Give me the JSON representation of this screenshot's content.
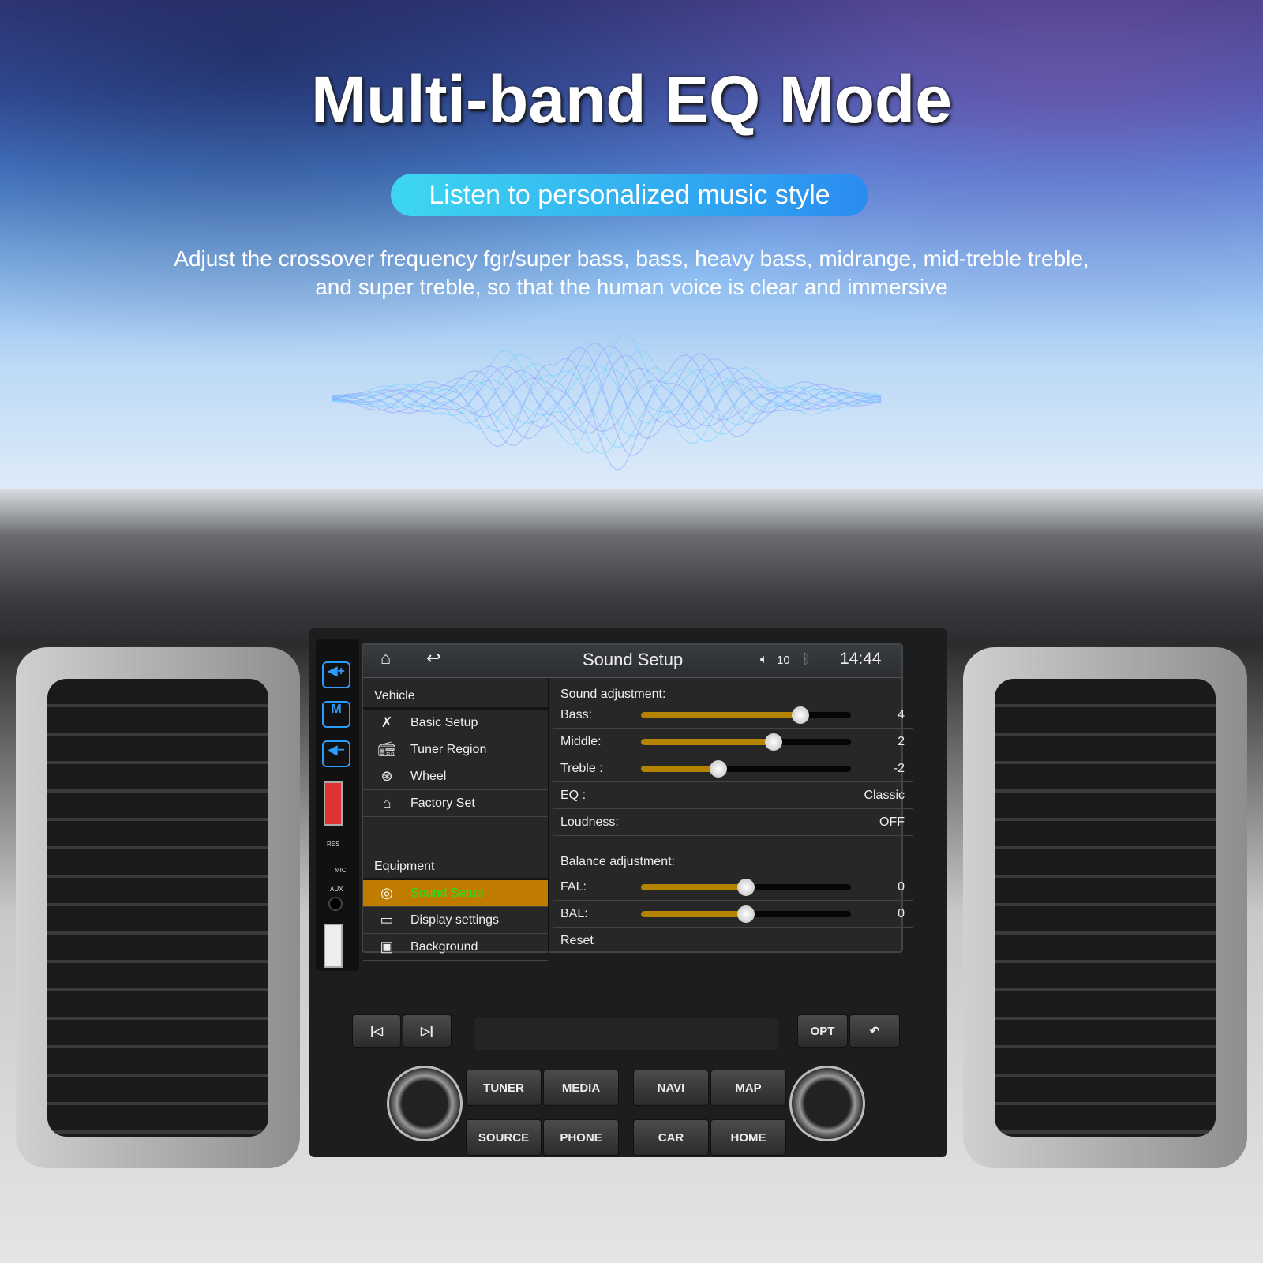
{
  "hero": {
    "title": "Multi-band EQ Mode",
    "subtitle": "Listen to personalized music style",
    "desc_line1": "Adjust the crossover frequency fgr/super bass, bass, heavy bass, midrange, mid-treble treble,",
    "desc_line2": "and super treble, so that the human voice is clear and immersive"
  },
  "header": {
    "title": "Sound Setup",
    "volume": "10",
    "time": "14:44",
    "icons": [
      "home-icon",
      "back-icon",
      "volume-icon",
      "bluetooth-icon"
    ]
  },
  "menu": {
    "vehicle_label": "Vehicle",
    "vehicle_items": [
      {
        "label": "Basic Setup",
        "icon": "tools-icon"
      },
      {
        "label": "Tuner Region",
        "icon": "radio-icon"
      },
      {
        "label": "Wheel",
        "icon": "steering-wheel-icon"
      },
      {
        "label": "Factory Set",
        "icon": "factory-icon"
      }
    ],
    "equipment_label": "Equipment",
    "equipment_items": [
      {
        "label": "Sound Setup",
        "icon": "speaker-icon",
        "selected": true
      },
      {
        "label": "Display settings",
        "icon": "display-icon"
      },
      {
        "label": "Background",
        "icon": "image-icon"
      }
    ]
  },
  "sound": {
    "heading": "Sound adjustment:",
    "bass": {
      "label": "Bass:",
      "value": "4",
      "percent": 76
    },
    "middle": {
      "label": "Middle:",
      "value": "2",
      "percent": 63
    },
    "treble": {
      "label": "Treble :",
      "value": "-2",
      "percent": 37
    },
    "eq": {
      "label": "EQ :",
      "value": "Classic"
    },
    "loudness": {
      "label": "Loudness:",
      "value": "OFF"
    }
  },
  "balance": {
    "heading": "Balance adjustment:",
    "fal": {
      "label": "FAL:",
      "value": "0",
      "percent": 50
    },
    "bal": {
      "label": "BAL:",
      "value": "0",
      "percent": 50
    },
    "reset": "Reset"
  },
  "panel": {
    "side_labels": {
      "res": "RES",
      "mic": "MIC",
      "aux": "AUX",
      "m": "M"
    },
    "buttons": {
      "opt": "OPT",
      "tuner": "TUNER",
      "media": "MEDIA",
      "navi": "NAVI",
      "map": "MAP",
      "source": "SOURCE",
      "phone": "PHONE",
      "car": "CAR",
      "home": "HOME"
    }
  },
  "colors": {
    "accent": "#c07c00",
    "slider": "#b48400",
    "selected_text": "#22e022",
    "hw_key": "#2a9dff"
  }
}
